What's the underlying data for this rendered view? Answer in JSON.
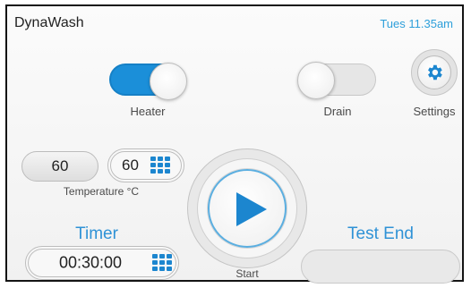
{
  "header": {
    "app_title": "DynaWash",
    "clock": "Tues  11.35am"
  },
  "heater": {
    "label": "Heater",
    "state": "on"
  },
  "drain": {
    "label": "Drain",
    "state": "off"
  },
  "settings": {
    "label": "Settings",
    "icon": "gear-icon"
  },
  "temperature": {
    "current_value": "60",
    "setpoint_value": "60",
    "label": "Temperature °C"
  },
  "timer": {
    "heading": "Timer",
    "value": "00:30:00"
  },
  "start": {
    "label": "Start",
    "icon": "play-icon"
  },
  "test_end": {
    "heading": "Test End",
    "value": ""
  },
  "colors": {
    "accent": "#1b8fd9",
    "heading_blue": "#2f92d6",
    "clock_blue": "#2d9fda"
  }
}
